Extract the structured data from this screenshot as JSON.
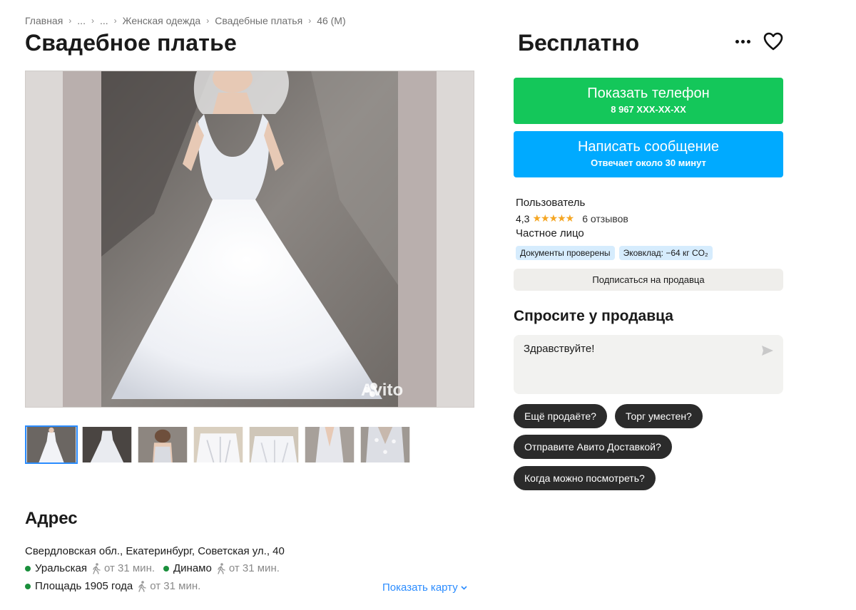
{
  "breadcrumb": {
    "items": [
      "Главная",
      "...",
      "...",
      "Женская одежда",
      "Свадебные платья",
      "46 (M)"
    ]
  },
  "listing": {
    "title": "Свадебное платье",
    "price": "Бесплатно",
    "watermark": "Avito"
  },
  "actions": {
    "phone_label": "Показать телефон",
    "phone_number": "8 967 XXX-XX-XX",
    "message_label": "Написать сообщение",
    "message_sub": "Отвечает около 30 минут"
  },
  "seller": {
    "name": "Пользователь",
    "rating": "4,3",
    "stars": "★★★★★",
    "reviews": "6 отзывов",
    "type": "Частное лицо",
    "badges": [
      "Документы проверены",
      "Эковклад: −64 кг CO₂"
    ],
    "subscribe_label": "Подписаться на продавца"
  },
  "ask": {
    "title": "Спросите у продавца",
    "input_value": "Здравствуйте!",
    "chips": [
      "Ещё продаёте?",
      "Торг уместен?",
      "Отправите Авито Доставкой?",
      "Когда можно посмотреть?"
    ]
  },
  "address": {
    "title": "Адрес",
    "text": "Свердловская обл., Екатеринбург, Советская ул., 40",
    "metro": [
      {
        "name": "Уральская",
        "time": "от 31 мин."
      },
      {
        "name": "Динамо",
        "time": "от 31 мин."
      },
      {
        "name": "Площадь 1905 года",
        "time": "от 31 мин."
      }
    ],
    "show_map": "Показать карту"
  },
  "colors": {
    "phone_button": "#14c75a",
    "message_button": "#00aaff",
    "link": "#2b8cff",
    "metro_dot": "#1a8f3c",
    "star": "#f5a623"
  },
  "icons": [
    "more-icon",
    "heart-icon",
    "send-icon",
    "walk-icon",
    "chevron-down-icon"
  ]
}
